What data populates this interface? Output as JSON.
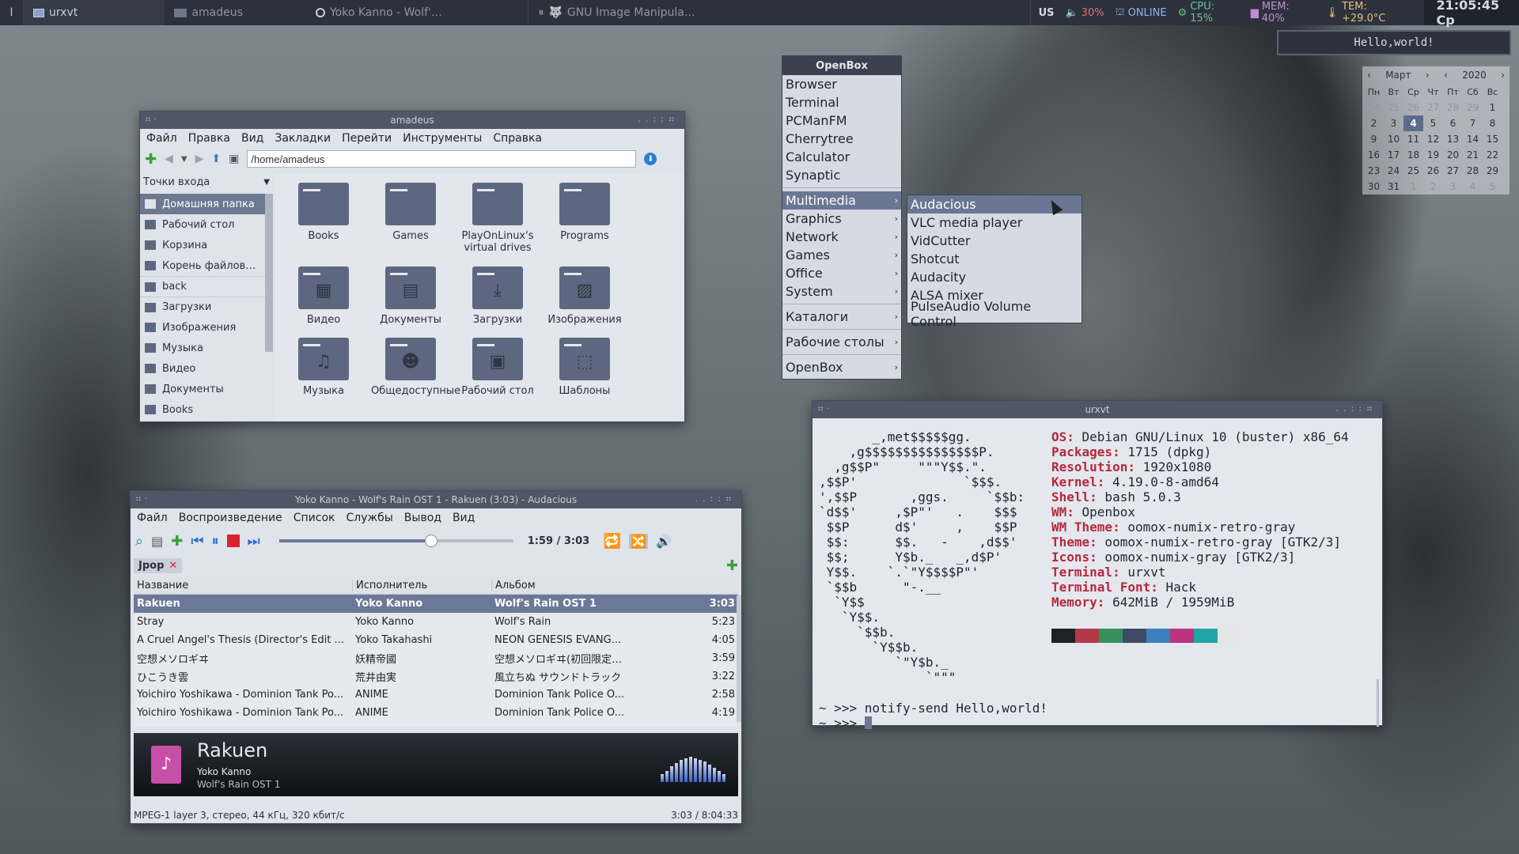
{
  "topbar": {
    "workspace": "I",
    "tasks": [
      {
        "label": "urxvt",
        "icon": "terminal-icon"
      },
      {
        "label": "amadeus",
        "icon": "folder-icon"
      },
      {
        "label": "Yoko Kanno - Wolf'…",
        "icon": "audacious-icon"
      }
    ],
    "pause_glyph": "⏸",
    "media_title": "GNU Image Manipula…",
    "layout": "US",
    "volume": "30%",
    "network": "ONLINE",
    "cpu": "CPU: 15%",
    "mem": "MEM: 40%",
    "temp": "TEM: +29.0°C",
    "clock": "21:05:45 Cp",
    "accent": "#1f232b"
  },
  "notification": {
    "text": "Hello,world!"
  },
  "calendar": {
    "month": "Март",
    "year": "2020",
    "weekdays": [
      "Пн",
      "Вт",
      "Ср",
      "Чт",
      "Пт",
      "Сб",
      "Вс"
    ],
    "rows": [
      [
        "24",
        "25",
        "26",
        "27",
        "28",
        "29",
        "1"
      ],
      [
        "2",
        "3",
        "4",
        "5",
        "6",
        "7",
        "8"
      ],
      [
        "9",
        "10",
        "11",
        "12",
        "13",
        "14",
        "15"
      ],
      [
        "16",
        "17",
        "18",
        "19",
        "20",
        "21",
        "22"
      ],
      [
        "23",
        "24",
        "25",
        "26",
        "27",
        "28",
        "29"
      ],
      [
        "30",
        "31",
        "1",
        "2",
        "3",
        "4",
        "5"
      ]
    ],
    "today": "4"
  },
  "filemanager": {
    "title": "amadeus",
    "menu": [
      "Файл",
      "Правка",
      "Вид",
      "Закладки",
      "Перейти",
      "Инструменты",
      "Справка"
    ],
    "path": "/home/amadeus",
    "sidebar_header": "Точки входа",
    "places": [
      "Домашняя папка",
      "Рабочий стол",
      "Корзина",
      "Корень файлов…",
      "back",
      "Загрузки",
      "Изображения",
      "Музыка",
      "Видео",
      "Документы",
      "Books"
    ],
    "folders": [
      {
        "name": "Books",
        "glyph": ""
      },
      {
        "name": "Games",
        "glyph": ""
      },
      {
        "name": "PlayOnLinux's virtual drives",
        "glyph": ""
      },
      {
        "name": "Programs",
        "glyph": ""
      },
      {
        "name": "Видео",
        "glyph": "▦"
      },
      {
        "name": "Документы",
        "glyph": "▤"
      },
      {
        "name": "Загрузки",
        "glyph": "⤓"
      },
      {
        "name": "Изображения",
        "glyph": "▨"
      },
      {
        "name": "Музыка",
        "glyph": "♫"
      },
      {
        "name": "Общедоступные",
        "glyph": "☻"
      },
      {
        "name": "Рабочий стол",
        "glyph": "▣"
      },
      {
        "name": "Шаблоны",
        "glyph": "⬚"
      }
    ]
  },
  "openbox": {
    "header": "OpenBox",
    "apps": [
      "Browser",
      "Terminal",
      "PCManFM",
      "Cherrytree",
      "Calculator",
      "Synaptic"
    ],
    "cats": [
      "Multimedia",
      "Graphics",
      "Network",
      "Games",
      "Office",
      "System"
    ],
    "extra": [
      "Каталоги",
      "Рабочие столы",
      "OpenBox"
    ],
    "sub": [
      "Audacious",
      "VLC media player",
      "VidCutter",
      "Shotcut",
      "Audacity",
      "ALSA mixer",
      "PulseAudio Volume Control"
    ]
  },
  "terminal": {
    "title": "urxvt",
    "logo": [
      "       _,met$$$$$gg.",
      "    ,g$$$$$$$$$$$$$$$P.",
      "  ,g$$P\"     \"\"\"Y$$.\".",
      ",$$P'              `$$$.",
      "',$$P       ,ggs.     `$$b:",
      "`d$$'     ,$P\"'   .    $$$",
      " $$P      d$'     ,    $$P",
      " $$:      $$.   -    ,d$$'",
      " $$;      Y$b._   _,d$P'",
      " Y$$.    `.`\"Y$$$$P\"'",
      " `$$b      \"-.__",
      "  `Y$$",
      "   `Y$$.",
      "     `$$b.",
      "       `Y$$b.",
      "          `\"Y$b._",
      "              `\"\"\""
    ],
    "info": [
      [
        "OS:",
        " Debian GNU/Linux 10 (buster) x86_64"
      ],
      [
        "Packages:",
        " 1715 (dpkg)"
      ],
      [
        "Resolution:",
        " 1920x1080"
      ],
      [
        "Kernel:",
        " 4.19.0-8-amd64"
      ],
      [
        "Shell:",
        " bash 5.0.3"
      ],
      [
        "WM:",
        " Openbox"
      ],
      [
        "WM Theme:",
        " oomox-numix-retro-gray"
      ],
      [
        "Theme:",
        " oomox-numix-retro-gray [GTK2/3]"
      ],
      [
        "Icons:",
        " oomox-numix-gray [GTK2/3]"
      ],
      [
        "Terminal:",
        " urxvt"
      ],
      [
        "Terminal Font:",
        " Hack"
      ],
      [
        "Memory:",
        " 642MiB / 1959MiB"
      ]
    ],
    "palette": [
      "#1f2128",
      "#b23a48",
      "#3a8f5e",
      "#3d4b66",
      "#3b7fbf",
      "#b9357d",
      "#22a3a8",
      "#e6e6e6"
    ],
    "cmd1": "~ >>> notify-send Hello,world!",
    "cmd2": "~ >>> "
  },
  "audacious": {
    "title": "Yoko Kanno - Wolf's Rain OST 1 - Rakuen (3:03) - Audacious",
    "menu": [
      "Файл",
      "Воспроизведение",
      "Список",
      "Службы",
      "Вывод",
      "Вид"
    ],
    "time": "1:59 / 3:03",
    "seek_fraction": 0.65,
    "tab": "Jpop",
    "headers": [
      "Название",
      "Исполнитель",
      "Альбом"
    ],
    "rows": [
      [
        "Rakuen",
        "Yoko Kanno",
        "Wolf's Rain OST 1",
        "3:03"
      ],
      [
        "Stray",
        "Yoko Kanno",
        "Wolf's Rain",
        "5:23"
      ],
      [
        "A Cruel Angel's Thesis (Director's Edit ...",
        "Yoko Takahashi",
        "NEON GENESIS EVANG...",
        "4:05"
      ],
      [
        "空想メソロギヰ",
        "妖精帝國",
        "空想メソロギヰ(初回限定…",
        "3:59"
      ],
      [
        "ひこうき雲",
        "荒井由実",
        "風立ちぬ サウンドトラック",
        "3:22"
      ],
      [
        "Yoichiro Yoshikawa - Dominion Tank Po...",
        "ANIME",
        "Dominion Tank Police O...",
        "2:58"
      ],
      [
        "Yoichiro Yoshikawa - Dominion Tank Po...",
        "ANIME",
        "Dominion Tank Police O...",
        "4:19"
      ]
    ],
    "now_title": "Rakuen",
    "now_artist": "Yoko Kanno",
    "now_album": "Wolf's Rain OST 1",
    "status_left": "MPEG-1 layer 3, стерео, 44 кГц, 320 кбит/с",
    "status_right": "3:03 / 8:04:33"
  }
}
